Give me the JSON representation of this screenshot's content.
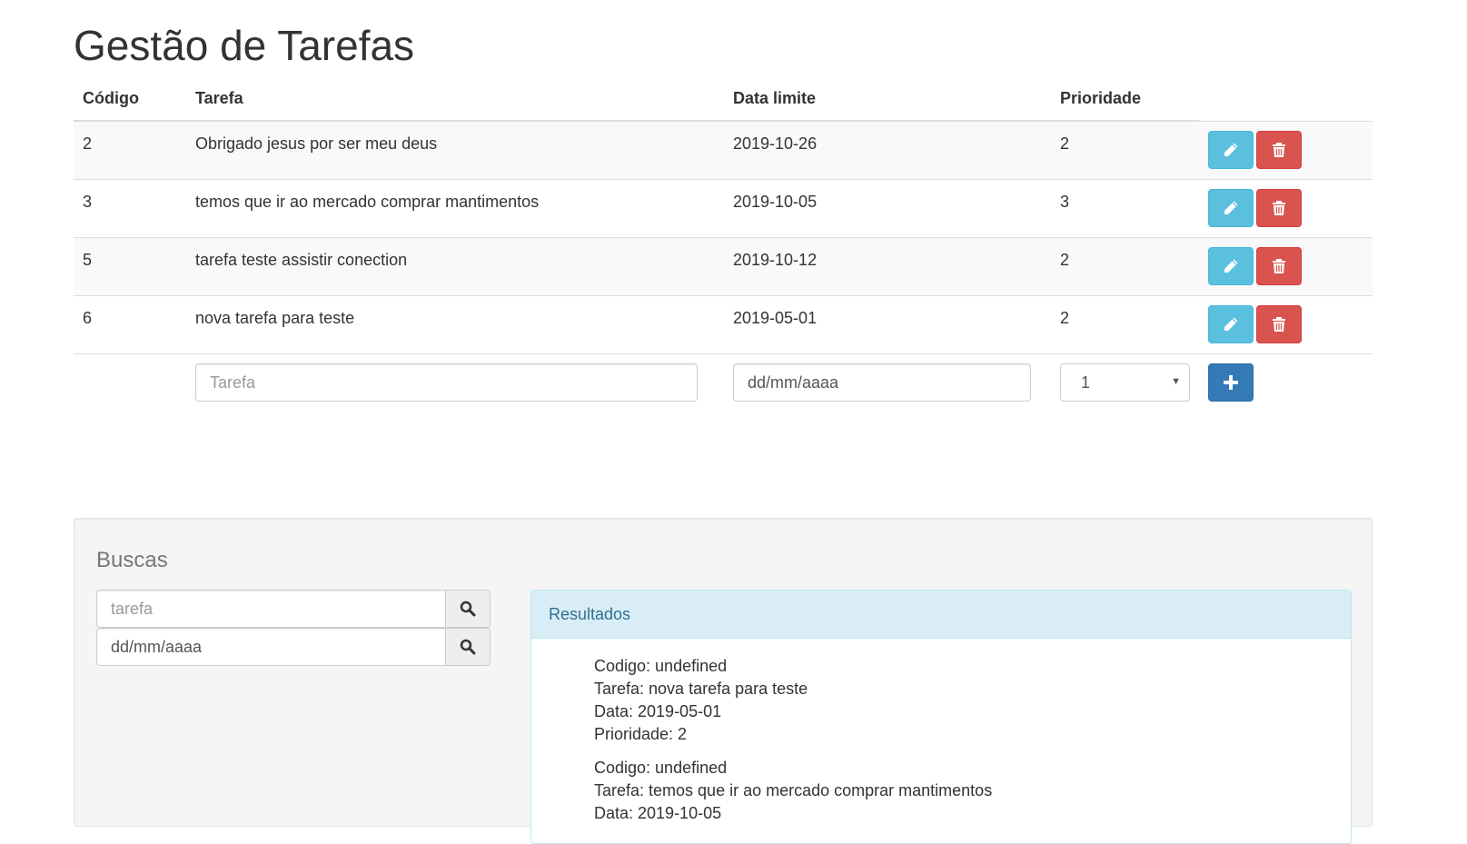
{
  "page": {
    "title": "Gestão de Tarefas"
  },
  "table": {
    "headers": {
      "code": "Código",
      "task": "Tarefa",
      "date": "Data limite",
      "priority": "Prioridade"
    },
    "rows": [
      {
        "code": "2",
        "task": "Obrigado jesus por ser meu deus",
        "date": "2019-10-26",
        "priority": "2"
      },
      {
        "code": "3",
        "task": "temos que ir ao mercado comprar mantimentos",
        "date": "2019-10-05",
        "priority": "3"
      },
      {
        "code": "5",
        "task": "tarefa teste assistir conection",
        "date": "2019-10-12",
        "priority": "2"
      },
      {
        "code": "6",
        "task": "nova tarefa para teste",
        "date": "2019-05-01",
        "priority": "2"
      }
    ],
    "new_row": {
      "task_placeholder": "Tarefa",
      "date_value": "dd/mm/aaaa",
      "priority_selected": "1"
    }
  },
  "search": {
    "title": "Buscas",
    "task_placeholder": "tarefa",
    "date_value": "dd/mm/aaaa"
  },
  "results": {
    "title": "Resultados",
    "items": [
      {
        "code": "Codigo: undefined",
        "task": "Tarefa: nova tarefa para teste",
        "date": "Data: 2019-05-01",
        "priority": "Prioridade: 2"
      },
      {
        "code": "Codigo: undefined",
        "task": "Tarefa: temos que ir ao mercado comprar mantimentos",
        "date": "Data: 2019-10-05",
        "priority": ""
      }
    ]
  },
  "icons": {
    "edit": "pencil-icon",
    "delete": "trash-icon",
    "add": "plus-icon",
    "search": "search-icon"
  },
  "colors": {
    "info": "#5bc0de",
    "danger": "#d9534f",
    "primary": "#337ab7",
    "panel": "#f5f5f5",
    "results_head": "#d9edf7"
  }
}
